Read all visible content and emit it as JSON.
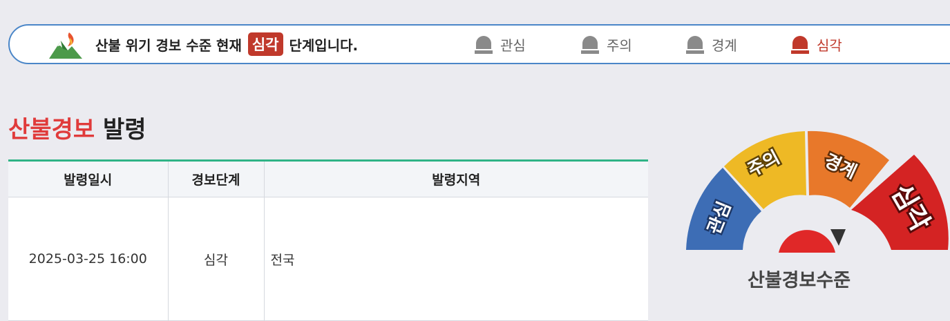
{
  "banner": {
    "message_prefix": "산불 위기 경보 수준 현재",
    "current_level": "심각",
    "message_suffix": "단계입니다.",
    "levels": [
      {
        "label": "관심",
        "active": false
      },
      {
        "label": "주의",
        "active": false
      },
      {
        "label": "경계",
        "active": false
      },
      {
        "label": "심각",
        "active": true
      }
    ]
  },
  "heading": {
    "highlight": "산불경보",
    "rest": "발령"
  },
  "table": {
    "headers": [
      "발령일시",
      "경보단계",
      "발령지역"
    ],
    "rows": [
      [
        "2025-03-25 16:00",
        "심각",
        "전국"
      ]
    ]
  },
  "gauge": {
    "segments": [
      {
        "label": "관심",
        "color": "#3d6db5"
      },
      {
        "label": "주의",
        "color": "#eeb925"
      },
      {
        "label": "경계",
        "color": "#e8782a"
      },
      {
        "label": "심각",
        "color": "#d42323"
      }
    ],
    "current": "심각",
    "caption": "산불경보수준"
  },
  "colors": {
    "accent_red": "#e03b3b",
    "badge_red": "#c0392b",
    "table_top_border": "#2fb386",
    "banner_border": "#4a86c8"
  }
}
